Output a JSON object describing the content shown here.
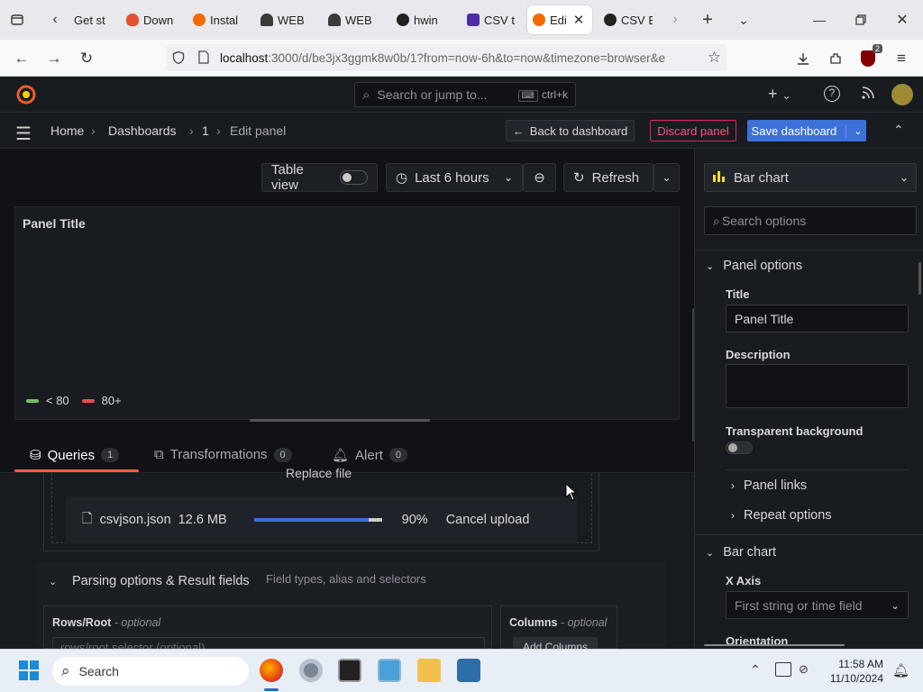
{
  "browser": {
    "tabs": [
      {
        "label": "Get st",
        "active": false
      },
      {
        "label": "Down",
        "active": false
      },
      {
        "label": "Instal",
        "active": false
      },
      {
        "label": "WEB",
        "active": false
      },
      {
        "label": "WEB",
        "active": false
      },
      {
        "label": "hwin",
        "active": false
      },
      {
        "label": "CSV t",
        "active": false
      },
      {
        "label": "Edi",
        "active": true
      },
      {
        "label": "CSV E",
        "active": false
      }
    ],
    "url_host": "localhost",
    "url_rest": ":3000/d/be3jx3ggmk8w0b/1?from=now-6h&to=now&timezone=browser&e",
    "extension_badge": "2"
  },
  "grafana": {
    "search_placeholder": "Search or jump to...",
    "search_shortcut": "ctrl+k",
    "breadcrumb": [
      "Home",
      "Dashboards",
      "1",
      "Edit panel"
    ],
    "back_button": "Back to dashboard",
    "discard_button": "Discard panel",
    "save_button": "Save dashboard",
    "table_view_label": "Table view",
    "time_range": "Last 6 hours",
    "refresh_label": "Refresh",
    "panel_title": "Panel Title",
    "legend": [
      {
        "label": "< 80",
        "color": "#73bf69"
      },
      {
        "label": "80+",
        "color": "#f2495c"
      }
    ],
    "query_tabs": [
      {
        "label": "Queries",
        "count": "1"
      },
      {
        "label": "Transformations",
        "count": "0"
      },
      {
        "label": "Alert",
        "count": "0"
      }
    ],
    "replace_file_label": "Replace file",
    "upload": {
      "file_name": "csvjson.json",
      "file_size": "12.6 MB",
      "progress": 0.9,
      "percent_label": "90%",
      "cancel_label": "Cancel upload"
    },
    "parsing": {
      "title": "Parsing options & Result fields",
      "subtitle": "Field types, alias and selectors",
      "rows_label": "Rows/Root",
      "rows_optional": "- optional",
      "rows_placeholder": "rows/root selector (optional)",
      "columns_label": "Columns",
      "columns_optional": "- optional",
      "add_columns_label": "Add Columns"
    },
    "options": {
      "visualization": "Bar chart",
      "search_placeholder": "Search options",
      "panel_options_header": "Panel options",
      "title_label": "Title",
      "title_value": "Panel Title",
      "description_label": "Description",
      "transparent_label": "Transparent background",
      "panel_links": "Panel links",
      "repeat_options": "Repeat options",
      "bar_chart_header": "Bar chart",
      "x_axis_label": "X Axis",
      "x_axis_placeholder": "First string or time field",
      "orientation_label": "Orientation"
    }
  },
  "taskbar": {
    "search_label": "Search",
    "time": "11:58 AM",
    "date": "11/10/2024"
  },
  "colors": {
    "accent_blue": "#3d71d9",
    "discard_red": "#e0226e",
    "orange_underline": "#f55f3e",
    "grafana_orange": "#f05a28"
  }
}
